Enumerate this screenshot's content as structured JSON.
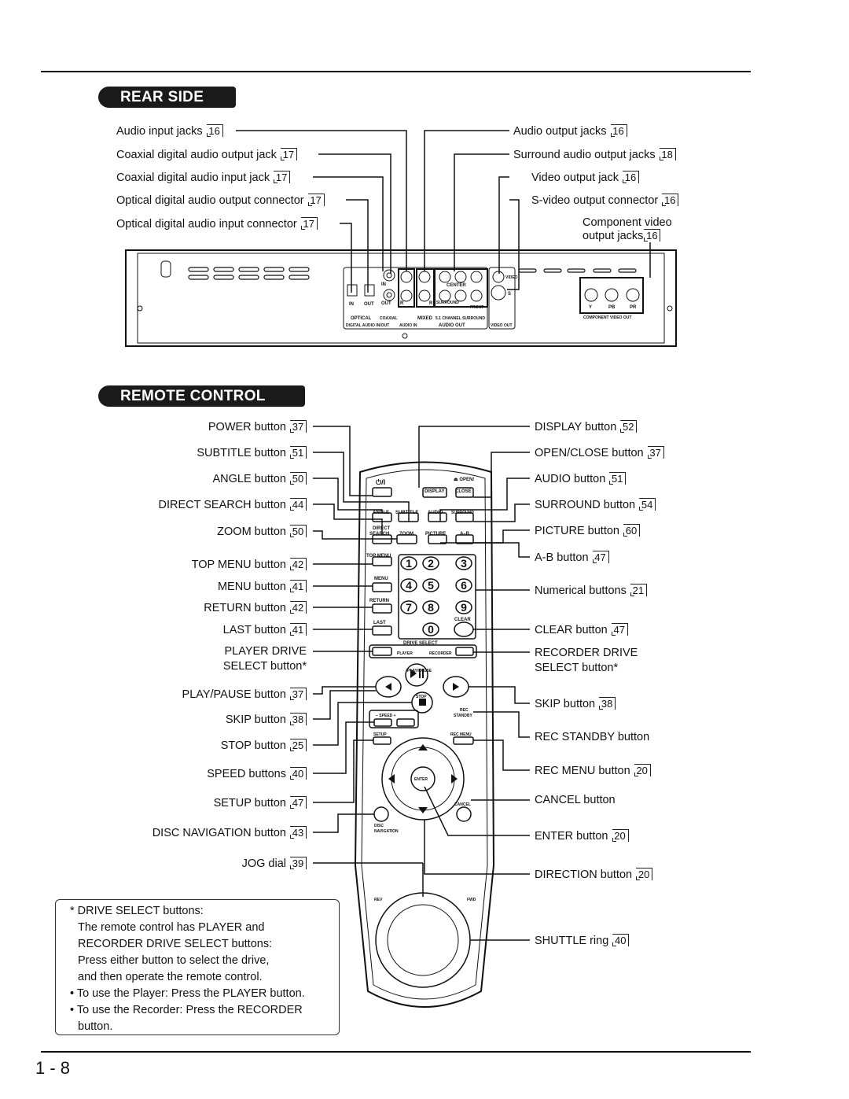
{
  "rear": {
    "title": "REAR SIDE",
    "left_labels": [
      {
        "text": "Audio input jacks",
        "ref": "16"
      },
      {
        "text": "Coaxial digital audio output jack",
        "ref": "17"
      },
      {
        "text": "Coaxial digital audio input jack",
        "ref": "17"
      },
      {
        "text": "Optical digital audio output connector",
        "ref": "17"
      },
      {
        "text": "Optical digital audio input connector",
        "ref": "17"
      }
    ],
    "right_labels": [
      {
        "text": "Audio output jacks",
        "ref": "16"
      },
      {
        "text": "Surround audio output jacks",
        "ref": "18"
      },
      {
        "text": "Video output jack",
        "ref": "16"
      },
      {
        "text": "S-video output connector",
        "ref": "16"
      }
    ],
    "component": {
      "line1": "Component video",
      "line2": "output jacks",
      "ref": "16"
    },
    "panel": {
      "in": "IN",
      "out": "OUT",
      "coax_in": "IN",
      "coax_out": "OUT",
      "l": "L",
      "r": "R",
      "center": "CENTER",
      "sub": "SUB",
      "woofer": "WOOFER",
      "surround": "SURROUND",
      "front": "FRONT",
      "video": "VIDEO",
      "s": "S",
      "y": "Y",
      "pb": "PB",
      "pr": "PR",
      "optical": "OPTICAL",
      "coaxial": "COAXIAL",
      "mixed": "MIXED",
      "ch51": "5.1 CHANNEL SURROUND",
      "digital": "DIGITAL AUDIO IN/OUT",
      "audio_in": "AUDIO IN",
      "audio_out": "AUDIO OUT",
      "video_out": "VIDEO OUT",
      "component_out": "COMPONENT VIDEO OUT"
    }
  },
  "remote": {
    "title": "REMOTE CONTROL",
    "left_labels": [
      {
        "text": "POWER button",
        "ref": "37"
      },
      {
        "text": "SUBTITLE button",
        "ref": "51"
      },
      {
        "text": "ANGLE button",
        "ref": "50"
      },
      {
        "text": "DIRECT SEARCH button",
        "ref": "44"
      },
      {
        "text": "ZOOM button",
        "ref": "50"
      },
      {
        "text": "TOP MENU button",
        "ref": "42"
      },
      {
        "text": "MENU button",
        "ref": "41"
      },
      {
        "text": "RETURN button",
        "ref": "42"
      },
      {
        "text": "LAST button",
        "ref": "41"
      },
      {
        "text": "PLAY/PAUSE button",
        "ref": "37"
      },
      {
        "text": "SKIP button",
        "ref": "38"
      },
      {
        "text": "STOP button",
        "ref": "25"
      },
      {
        "text": "SPEED buttons",
        "ref": "40"
      },
      {
        "text": "SETUP button",
        "ref": "47"
      },
      {
        "text": "DISC NAVIGATION button",
        "ref": "43"
      },
      {
        "text": "JOG dial",
        "ref": "39"
      }
    ],
    "player_drive": {
      "line1": "PLAYER DRIVE",
      "line2": "SELECT button*"
    },
    "right_labels": [
      {
        "text": "DISPLAY button",
        "ref": "52"
      },
      {
        "text": "OPEN/CLOSE button",
        "ref": "37"
      },
      {
        "text": "AUDIO button",
        "ref": "51"
      },
      {
        "text": "SURROUND button",
        "ref": "54"
      },
      {
        "text": "PICTURE button",
        "ref": "60"
      },
      {
        "text": "A-B button",
        "ref": "47"
      },
      {
        "text": "Numerical buttons",
        "ref": "21"
      },
      {
        "text": "CLEAR button",
        "ref": "47"
      },
      {
        "text": "SKIP button",
        "ref": "38"
      },
      {
        "text": "REC STANDBY button",
        "ref": ""
      },
      {
        "text": "REC MENU button",
        "ref": "20"
      },
      {
        "text": "CANCEL button",
        "ref": ""
      },
      {
        "text": "ENTER button",
        "ref": "20"
      },
      {
        "text": "DIRECTION button",
        "ref": "20"
      },
      {
        "text": "SHUTTLE ring",
        "ref": "40"
      }
    ],
    "recorder_drive": {
      "line1": "RECORDER DRIVE",
      "line2": "SELECT button*"
    },
    "keys": {
      "power": "⏻/I",
      "display": "DISPLAY",
      "open": "⏏ OPEN/",
      "close": "CLOSE",
      "angle": "ANGLE",
      "subtitle": "SUBTITLE",
      "audio": "AUDIO",
      "surround": "SURROUND",
      "direct": "DIRECT",
      "search": "SEARCH",
      "zoom": "ZOOM",
      "picture": "PICTURE",
      "ab": "A–B",
      "top_menu": "TOP MENU",
      "menu": "MENU",
      "return": "RETURN",
      "last": "LAST",
      "clear": "CLEAR",
      "numbers": [
        "1",
        "2",
        "3",
        "4",
        "5",
        "6",
        "7",
        "8",
        "9",
        "0"
      ],
      "drive_select": "DRIVE SELECT",
      "player": "PLAYER",
      "recorder": "RECORDER",
      "play_pause": "PLAY/PAUSE",
      "stop": "STOP",
      "speed": "−  SPEED  +",
      "rec": "REC",
      "standby": "STANDBY",
      "setup": "SETUP",
      "rec_menu": "REC MENU",
      "enter": "ENTER",
      "cancel": "CANCEL",
      "disc": "DISC",
      "navigation": "NAVIGATION",
      "rev": "REV",
      "fwd": "FWD"
    }
  },
  "note": {
    "lines": [
      "* DRIVE SELECT buttons:",
      "The remote control has PLAYER and",
      "RECORDER DRIVE SELECT buttons:",
      "Press either button to select the drive,",
      "and then operate the remote control.",
      "• To use the Player: Press the PLAYER button.",
      "• To use the Recorder:  Press the RECORDER",
      "button."
    ]
  },
  "page_number": "1 - 8"
}
